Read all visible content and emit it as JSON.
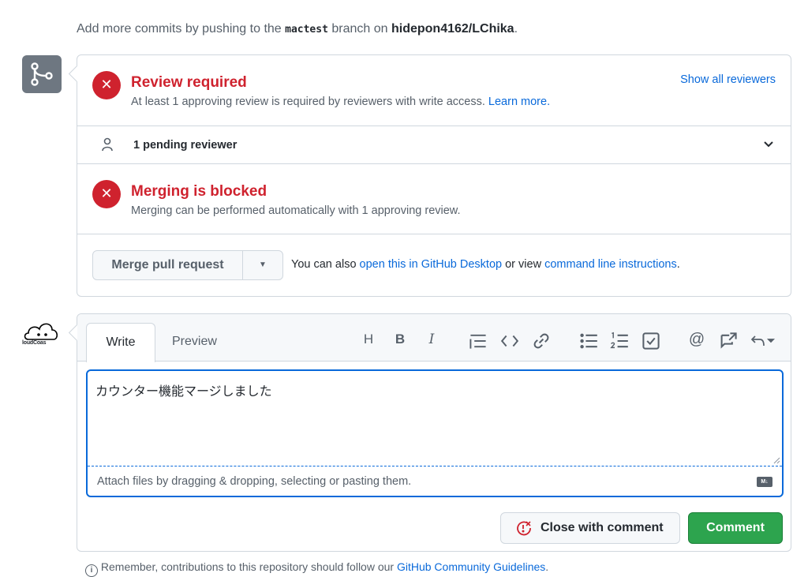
{
  "top_note": {
    "prefix": "Add more commits by pushing to the ",
    "branch": "mactest",
    "middle": " branch on ",
    "repo": "hidepon4162/LChika",
    "suffix": "."
  },
  "review": {
    "title": "Review required",
    "subtitle": "At least 1 approving review is required by reviewers with write access.",
    "learn_more": "Learn more.",
    "show_all": "Show all reviewers",
    "pending": "1 pending reviewer"
  },
  "merge": {
    "title": "Merging is blocked",
    "subtitle": "Merging can be performed automatically with 1 approving review.",
    "button": "Merge pull request",
    "also_prefix": "You can also ",
    "desktop_link": "open this in GitHub Desktop",
    "also_mid": " or view ",
    "cli_link": "command line instructions",
    "also_suffix": "."
  },
  "avatar": {
    "text": "loudCoas"
  },
  "comment": {
    "tab_write": "Write",
    "tab_preview": "Preview",
    "toolbar": [
      "heading-icon",
      "bold-icon",
      "italic-icon",
      "quote-icon",
      "code-icon",
      "link-icon",
      "bullet-list-icon",
      "numbered-list-icon",
      "task-list-icon",
      "mention-icon",
      "reference-icon",
      "reply-icon"
    ],
    "text": "カウンター機能マージしました",
    "attach_hint": "Attach files by dragging & dropping, selecting or pasting them.",
    "close_label": "Close with comment",
    "comment_label": "Comment"
  },
  "footer": {
    "prefix": "Remember, contributions to this repository should follow our ",
    "link": "GitHub Community Guidelines",
    "suffix": "."
  },
  "colors": {
    "danger": "#cf222e",
    "accent": "#0969da",
    "primary": "#2da44e"
  }
}
